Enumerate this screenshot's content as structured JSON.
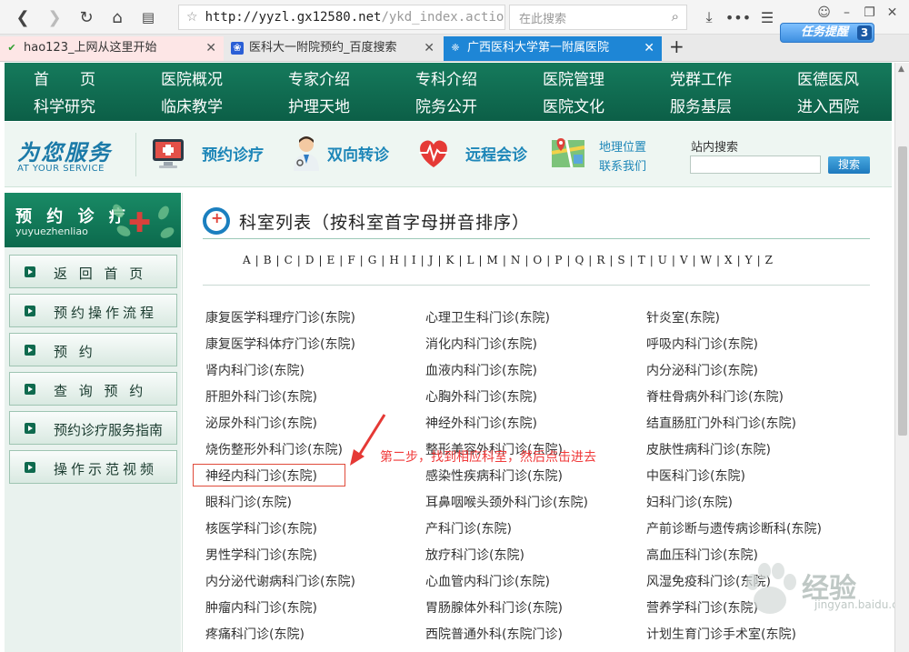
{
  "browser": {
    "url_host": "http://yyzl.gx12580.net",
    "url_path": "/ykd_index.action",
    "search_placeholder": "在此搜索",
    "tabs": [
      {
        "label": "hao123_上网从这里开始"
      },
      {
        "label": "医科大一附院预约_百度搜索"
      },
      {
        "label": "广西医科大学第一附属医院"
      }
    ],
    "task_badge": {
      "label": "任务提醒",
      "count": "3"
    }
  },
  "mainnav": {
    "row1": [
      "首　　页",
      "医院概况",
      "专家介绍",
      "专科介绍",
      "医院管理",
      "党群工作",
      "医德医风"
    ],
    "row2": [
      "科学研究",
      "临床教学",
      "护理天地",
      "院务公开",
      "医院文化",
      "服务基层",
      "进入西院"
    ]
  },
  "service": {
    "logo": "为您服务",
    "logo_sub": "AT YOUR SERVICE",
    "items": [
      "预约诊疗",
      "双向转诊",
      "远程会诊"
    ],
    "geo": [
      "地理位置",
      "联系我们"
    ],
    "search_label": "站内搜索",
    "search_button": "搜索"
  },
  "sidebar": {
    "title": "预 约 诊 疗",
    "pinyin": "yuyuezhenliao",
    "items": [
      "返 回 首 页",
      "预约操作流程",
      "预 约",
      "查 询 预 约",
      "预约诊疗服务指南",
      "操作示范视频"
    ]
  },
  "content": {
    "title": "科室列表（按科室首字母拼音排序）",
    "letters": [
      "A",
      "B",
      "C",
      "D",
      "E",
      "F",
      "G",
      "H",
      "I",
      "J",
      "K",
      "L",
      "M",
      "N",
      "O",
      "P",
      "Q",
      "R",
      "S",
      "T",
      "U",
      "V",
      "W",
      "X",
      "Y",
      "Z"
    ],
    "departments": [
      [
        "康复医学科理疗门诊(东院)",
        "心理卫生科门诊(东院)",
        "针炎室(东院)"
      ],
      [
        "康复医学科体疗门诊(东院)",
        "消化内科门诊(东院)",
        "呼吸内科门诊(东院)"
      ],
      [
        "肾内科门诊(东院)",
        "血液内科门诊(东院)",
        "内分泌科门诊(东院)"
      ],
      [
        "肝胆外科门诊(东院)",
        "心胸外科门诊(东院)",
        "脊柱骨病外科门诊(东院)"
      ],
      [
        "泌尿外科门诊(东院)",
        "神经外科门诊(东院)",
        "结直肠肛门外科门诊(东院)"
      ],
      [
        "烧伤整形外科门诊(东院)",
        "整形美容外科门诊(东院)",
        "皮肤性病科门诊(东院)"
      ],
      [
        "神经内科门诊(东院)",
        "感染性疾病科门诊(东院)",
        "中医科门诊(东院)"
      ],
      [
        "眼科门诊(东院)",
        "耳鼻咽喉头颈外科门诊(东院)",
        "妇科门诊(东院)"
      ],
      [
        "核医学科门诊(东院)",
        "产科门诊(东院)",
        "产前诊断与遗传病诊断科(东院)"
      ],
      [
        "男性学科门诊(东院)",
        "放疗科门诊(东院)",
        "高血压科门诊(东院)"
      ],
      [
        "内分泌代谢病科门诊(东院)",
        "心血管内科门诊(东院)",
        "风湿免疫科门诊(东院)"
      ],
      [
        "肿瘤内科门诊(东院)",
        "胃肠腺体外科门诊(东院)",
        "营养学科门诊(东院)"
      ],
      [
        "疼痛科门诊(东院)",
        "西院普通外科(东院门诊)",
        "计划生育门诊手术室(东院)"
      ]
    ],
    "annotation": "第二步，找到相应科室，然后点击进去"
  },
  "watermark": {
    "text": "经验",
    "url": "jingyan.baidu.com"
  }
}
